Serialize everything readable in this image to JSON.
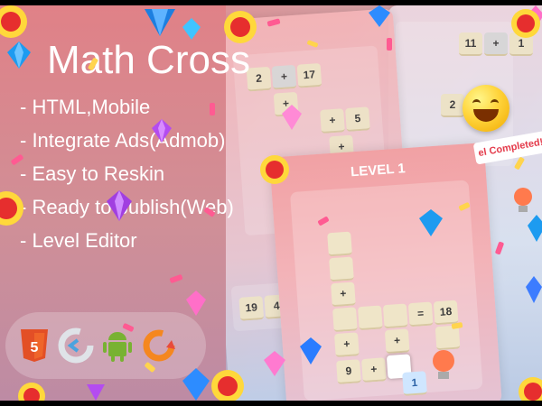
{
  "promo": {
    "title": "Math Cross",
    "features": [
      "- HTML,Mobile",
      "- Integrate Ads(Admob)",
      "- Easy to Reskin",
      "- Ready to publish(Web)",
      "- Level Editor"
    ],
    "tech_logos": [
      "html5-logo-icon",
      "construct-logo-icon",
      "android-logo-icon",
      "orange-loop-logo-icon"
    ]
  },
  "level_card": {
    "title": "LEVEL 1",
    "tiles": [
      "+",
      "=",
      "18",
      "+",
      "+",
      "9",
      "+",
      "1"
    ]
  },
  "background_cards": {
    "left": [
      "2",
      "+",
      "17",
      "+",
      "+",
      "5",
      "+"
    ],
    "right": [
      "11",
      "+",
      "1",
      "2",
      "+"
    ],
    "left_bottom": [
      "19",
      "4"
    ]
  },
  "banner": {
    "text": "el Completed!"
  },
  "colors": {
    "accent_red": "#e43b4b",
    "gem_blue": "#1d9bf0",
    "gem_purple": "#b44cf0",
    "gem_pink": "#ff8ad6",
    "confetti_pink": "#ff5b92",
    "confetti_yellow": "#ffd44d"
  }
}
